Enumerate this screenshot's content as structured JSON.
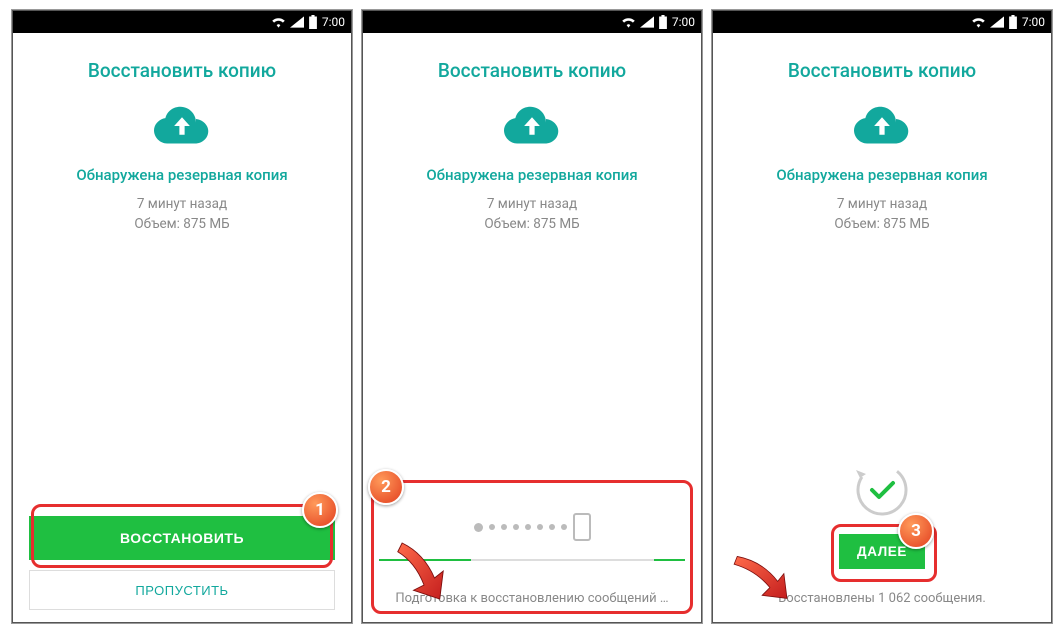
{
  "statusbar": {
    "time": "7:00"
  },
  "screen1": {
    "title": "Восстановить копию",
    "found": "Обнаружена резервная копия",
    "when": "7 минут назад",
    "size": "Объем: 875 МБ",
    "btnRestore": "ВОССТАНОВИТЬ",
    "btnSkip": "ПРОПУСТИТЬ"
  },
  "screen2": {
    "title": "Восстановить копию",
    "found": "Обнаружена резервная копия",
    "when": "7 минут назад",
    "size": "Объем: 875 МБ",
    "status": "Подготовка к восстановлению сообщений …"
  },
  "screen3": {
    "title": "Восстановить копию",
    "found": "Обнаружена резервная копия",
    "when": "7 минут назад",
    "size": "Объем: 875 МБ",
    "btnNext": "ДАЛЕЕ",
    "status": "Восстановлены 1 062 сообщения."
  },
  "badges": {
    "one": "1",
    "two": "2",
    "three": "3"
  }
}
